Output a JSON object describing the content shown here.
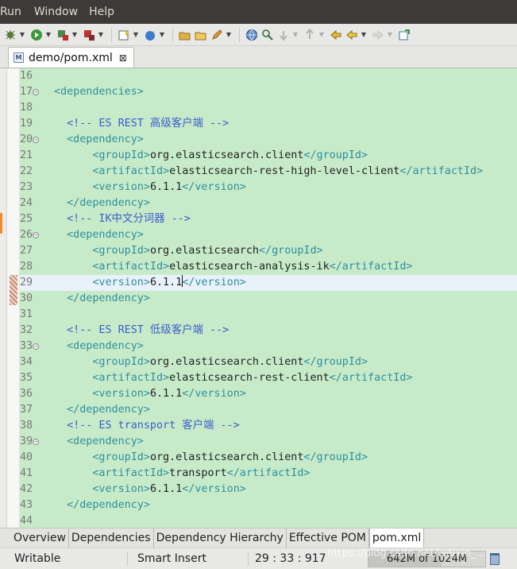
{
  "menubar": [
    "Run",
    "Window",
    "Help"
  ],
  "editor_tab": {
    "title": "demo/pom.xml",
    "icon": "maven-pom-icon",
    "close_glyph": "⊠"
  },
  "lines": [
    {
      "n": "16",
      "fold": false,
      "parts": []
    },
    {
      "n": "17",
      "fold": true,
      "parts": [
        {
          "t": "<dependencies>",
          "c": "tag"
        }
      ]
    },
    {
      "n": "18",
      "fold": false,
      "parts": []
    },
    {
      "n": "19",
      "fold": false,
      "parts": [
        {
          "t": "  <!-- ES REST 高级客户端 -->",
          "c": "cmt"
        }
      ]
    },
    {
      "n": "20",
      "fold": true,
      "parts": [
        {
          "t": "  <dependency>",
          "c": "tag"
        }
      ]
    },
    {
      "n": "21",
      "fold": false,
      "parts": [
        {
          "t": "      <groupId>",
          "c": "tag"
        },
        {
          "t": "org.elasticsearch.client",
          "c": "txt"
        },
        {
          "t": "</groupId>",
          "c": "tag"
        }
      ]
    },
    {
      "n": "22",
      "fold": false,
      "parts": [
        {
          "t": "      <artifactId>",
          "c": "tag"
        },
        {
          "t": "elasticsearch-rest-high-level-client",
          "c": "txt"
        },
        {
          "t": "</artifactId>",
          "c": "tag"
        }
      ]
    },
    {
      "n": "23",
      "fold": false,
      "parts": [
        {
          "t": "      <version>",
          "c": "tag"
        },
        {
          "t": "6.1.1",
          "c": "txt"
        },
        {
          "t": "</version>",
          "c": "tag"
        }
      ]
    },
    {
      "n": "24",
      "fold": false,
      "parts": [
        {
          "t": "  </dependency>",
          "c": "tag"
        }
      ]
    },
    {
      "n": "25",
      "fold": false,
      "parts": [
        {
          "t": "  <!-- IK中文分词器 -->",
          "c": "cmt"
        }
      ]
    },
    {
      "n": "26",
      "fold": true,
      "parts": [
        {
          "t": "  <dependency>",
          "c": "tag"
        }
      ]
    },
    {
      "n": "27",
      "fold": false,
      "parts": [
        {
          "t": "      <groupId>",
          "c": "tag"
        },
        {
          "t": "org.elasticsearch",
          "c": "txt"
        },
        {
          "t": "</groupId>",
          "c": "tag"
        }
      ]
    },
    {
      "n": "28",
      "fold": false,
      "parts": [
        {
          "t": "      <artifactId>",
          "c": "tag"
        },
        {
          "t": "elasticsearch-analysis-ik",
          "c": "txt"
        },
        {
          "t": "</artifactId>",
          "c": "tag"
        }
      ]
    },
    {
      "n": "29",
      "fold": false,
      "current": true,
      "parts": [
        {
          "t": "      <version>",
          "c": "tag"
        },
        {
          "t": "6.1.1",
          "c": "txt"
        },
        {
          "t": "|cursor|",
          "c": "cursor"
        },
        {
          "t": "</version>",
          "c": "tag"
        }
      ]
    },
    {
      "n": "30",
      "fold": false,
      "parts": [
        {
          "t": "  </dependency>",
          "c": "tag"
        }
      ]
    },
    {
      "n": "31",
      "fold": false,
      "parts": []
    },
    {
      "n": "32",
      "fold": false,
      "parts": [
        {
          "t": "  <!-- ES REST 低级客户端 -->",
          "c": "cmt"
        }
      ]
    },
    {
      "n": "33",
      "fold": true,
      "parts": [
        {
          "t": "  <dependency>",
          "c": "tag"
        }
      ]
    },
    {
      "n": "34",
      "fold": false,
      "parts": [
        {
          "t": "      <groupId>",
          "c": "tag"
        },
        {
          "t": "org.elasticsearch.client",
          "c": "txt"
        },
        {
          "t": "</groupId>",
          "c": "tag"
        }
      ]
    },
    {
      "n": "35",
      "fold": false,
      "parts": [
        {
          "t": "      <artifactId>",
          "c": "tag"
        },
        {
          "t": "elasticsearch-rest-client",
          "c": "txt"
        },
        {
          "t": "</artifactId>",
          "c": "tag"
        }
      ]
    },
    {
      "n": "36",
      "fold": false,
      "parts": [
        {
          "t": "      <version>",
          "c": "tag"
        },
        {
          "t": "6.1.1",
          "c": "txt"
        },
        {
          "t": "</version>",
          "c": "tag"
        }
      ]
    },
    {
      "n": "37",
      "fold": false,
      "parts": [
        {
          "t": "  </dependency>",
          "c": "tag"
        }
      ]
    },
    {
      "n": "38",
      "fold": false,
      "parts": [
        {
          "t": "  <!-- ES transport 客户端 -->",
          "c": "cmt"
        }
      ]
    },
    {
      "n": "39",
      "fold": true,
      "parts": [
        {
          "t": "  <dependency>",
          "c": "tag"
        }
      ]
    },
    {
      "n": "40",
      "fold": false,
      "parts": [
        {
          "t": "      <groupId>",
          "c": "tag"
        },
        {
          "t": "org.elasticsearch.client",
          "c": "txt"
        },
        {
          "t": "</groupId>",
          "c": "tag"
        }
      ]
    },
    {
      "n": "41",
      "fold": false,
      "parts": [
        {
          "t": "      <artifactId>",
          "c": "tag"
        },
        {
          "t": "transport",
          "c": "txt"
        },
        {
          "t": "</artifactId>",
          "c": "tag"
        }
      ]
    },
    {
      "n": "42",
      "fold": false,
      "parts": [
        {
          "t": "      <version>",
          "c": "tag"
        },
        {
          "t": "6.1.1",
          "c": "txt"
        },
        {
          "t": "</version>",
          "c": "tag"
        }
      ]
    },
    {
      "n": "43",
      "fold": false,
      "parts": [
        {
          "t": "  </dependency>",
          "c": "tag"
        }
      ]
    },
    {
      "n": "44",
      "fold": false,
      "parts": []
    }
  ],
  "page_tabs": [
    "Overview",
    "Dependencies",
    "Dependency Hierarchy",
    "Effective POM",
    "pom.xml"
  ],
  "active_page_tab": 4,
  "status": {
    "writable": "Writable",
    "insert_mode": "Smart Insert",
    "position": "29 : 33 : 917",
    "heap": "642M of 1024M",
    "heap_fraction": 0.627
  },
  "watermark": "https://blog.csdn.net/weixin_...",
  "colors": {
    "editor_bg": "#c7ebc9",
    "tag": "#2e8fa0",
    "comment": "#3b5ccc",
    "current_line": "#e9f1fb"
  }
}
